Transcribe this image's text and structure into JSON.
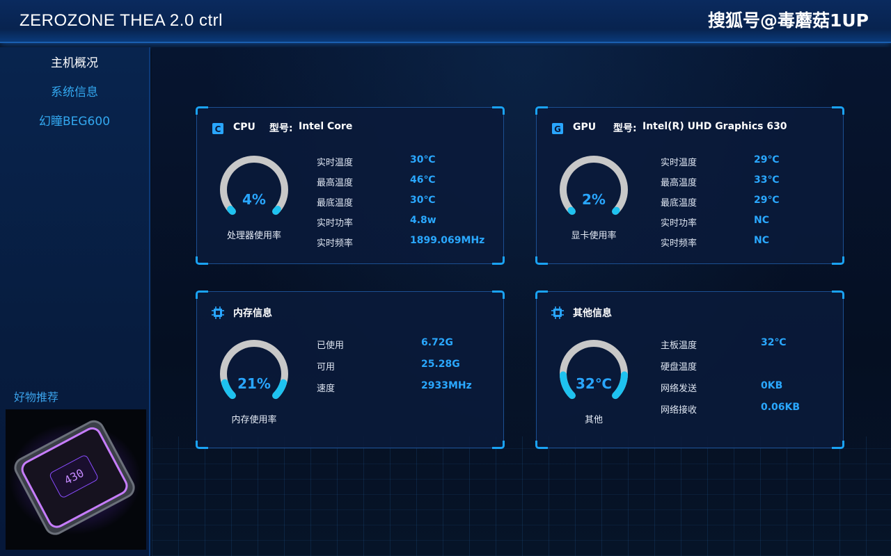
{
  "app": {
    "title": "ZEROZONE THEA 2.0 ctrl",
    "watermark": "搜狐号@毒蘑菇1UP"
  },
  "sidebar": {
    "items": [
      {
        "label": "主机概况"
      },
      {
        "label": "系统信息"
      },
      {
        "label": "幻瞳BEG600"
      }
    ],
    "recommend_label": "好物推荐",
    "product_display_text": "430"
  },
  "panels": {
    "cpu": {
      "icon": "cpu-icon",
      "icon_letter": "C",
      "title": "CPU",
      "model_label": "型号:",
      "model_value": "Intel Core",
      "usage_fraction": 0.04,
      "usage_text": "4%",
      "usage_caption": "处理器使用率",
      "rows": [
        {
          "label": "实时温度",
          "value": "30℃"
        },
        {
          "label": "最高温度",
          "value": "46℃"
        },
        {
          "label": "最底温度",
          "value": "30℃"
        },
        {
          "label": "实时功率",
          "value": "4.8w"
        },
        {
          "label": "实时频率",
          "value": "1899.069MHz"
        }
      ]
    },
    "gpu": {
      "icon": "gpu-icon",
      "icon_letter": "G",
      "title": "GPU",
      "model_label": "型号:",
      "model_value": "Intel(R) UHD Graphics 630",
      "usage_fraction": 0.02,
      "usage_text": "2%",
      "usage_caption": "显卡使用率",
      "rows": [
        {
          "label": "实时温度",
          "value": "29℃"
        },
        {
          "label": "最高温度",
          "value": "33℃"
        },
        {
          "label": "最底温度",
          "value": "29℃"
        },
        {
          "label": "实时功率",
          "value": "NC"
        },
        {
          "label": "实时频率",
          "value": "NC"
        }
      ]
    },
    "memory": {
      "icon": "memory-chip-icon",
      "title": "内存信息",
      "usage_fraction": 0.21,
      "usage_text": "21%",
      "usage_caption": "内存使用率",
      "rows": [
        {
          "label": "已使用",
          "value": "6.72G"
        },
        {
          "label": "可用",
          "value": "25.28G"
        },
        {
          "label": "速度",
          "value": "2933MHz"
        }
      ]
    },
    "other": {
      "icon": "chip-icon",
      "title": "其他信息",
      "usage_fraction": 0.32,
      "usage_text": "32℃",
      "usage_caption": "其他",
      "rows": [
        {
          "label": "主板温度",
          "value": "32℃"
        },
        {
          "label": "硬盘温度",
          "value": ""
        },
        {
          "label": "网络发送",
          "value": "0KB"
        },
        {
          "label": "网络接收",
          "value": "0.06KB"
        }
      ]
    }
  },
  "colors": {
    "accent": "#29a6ff",
    "gauge_track": "#c8c8c8",
    "gauge_fill": "#1ec2f0",
    "panel_corner": "#1aa3f5"
  }
}
